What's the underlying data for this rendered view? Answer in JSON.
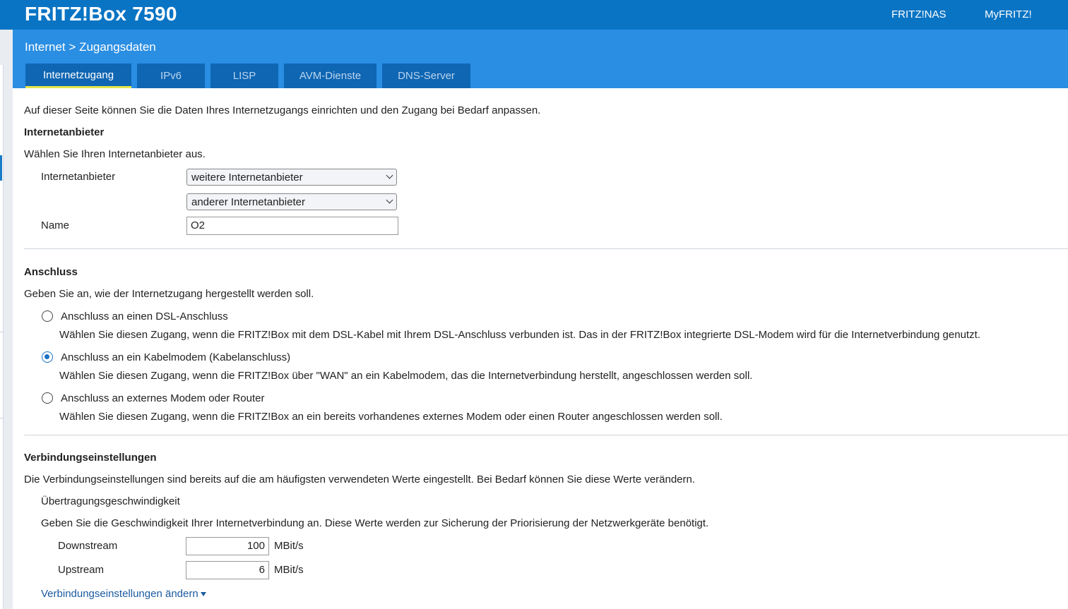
{
  "header": {
    "brand": "FRITZ!Box 7590",
    "links": [
      "FRITZ!NAS",
      "MyFRITZ!"
    ]
  },
  "breadcrumb": {
    "parent": "Internet",
    "separator": ">",
    "current": "Zugangsdaten"
  },
  "tabs": [
    {
      "label": "Internetzugang",
      "active": true
    },
    {
      "label": "IPv6",
      "active": false
    },
    {
      "label": "LISP",
      "active": false
    },
    {
      "label": "AVM-Dienste",
      "active": false
    },
    {
      "label": "DNS-Server",
      "active": false
    }
  ],
  "intro": "Auf dieser Seite können Sie die Daten Ihres Internetzugangs einrichten und den Zugang bei Bedarf anpassen.",
  "provider": {
    "heading": "Internetanbieter",
    "description": "Wählen Sie Ihren Internetanbieter aus.",
    "provider_label": "Internetanbieter",
    "select1_value": "weitere Internetanbieter",
    "select2_value": "anderer Internetanbieter",
    "name_label": "Name",
    "name_value": "O2"
  },
  "connection": {
    "heading": "Anschluss",
    "description": "Geben Sie an, wie der Internetzugang hergestellt werden soll.",
    "options": [
      {
        "label": "Anschluss an einen DSL-Anschluss",
        "hint": "Wählen Sie diesen Zugang, wenn die FRITZ!Box mit dem DSL-Kabel mit Ihrem DSL-Anschluss verbunden ist. Das in der FRITZ!Box integrierte DSL-Modem wird für die Internetverbindung genutzt.",
        "checked": false
      },
      {
        "label": "Anschluss an ein Kabelmodem (Kabelanschluss)",
        "hint": "Wählen Sie diesen Zugang, wenn die FRITZ!Box über \"WAN\" an ein Kabelmodem, das die Internetverbindung herstellt, angeschlossen werden soll.",
        "checked": true
      },
      {
        "label": "Anschluss an externes Modem oder Router",
        "hint": "Wählen Sie diesen Zugang, wenn die FRITZ!Box an ein bereits vorhandenes externes Modem oder einen Router angeschlossen werden soll.",
        "checked": false
      }
    ]
  },
  "settings": {
    "heading": "Verbindungseinstellungen",
    "description": "Die Verbindungseinstellungen sind bereits auf die am häufigsten verwendeten Werte eingestellt. Bei Bedarf können Sie diese Werte verändern.",
    "speed_heading": "Übertragungsgeschwindigkeit",
    "speed_description": "Geben Sie die Geschwindigkeit Ihrer Internetverbindung an. Diese Werte werden zur Sicherung der Priorisierung der Netzwerkgeräte benötigt.",
    "downstream_label": "Downstream",
    "downstream_value": "100",
    "upstream_label": "Upstream",
    "upstream_value": "6",
    "unit": "MBit/s",
    "change_link": "Verbindungseinstellungen ändern"
  }
}
